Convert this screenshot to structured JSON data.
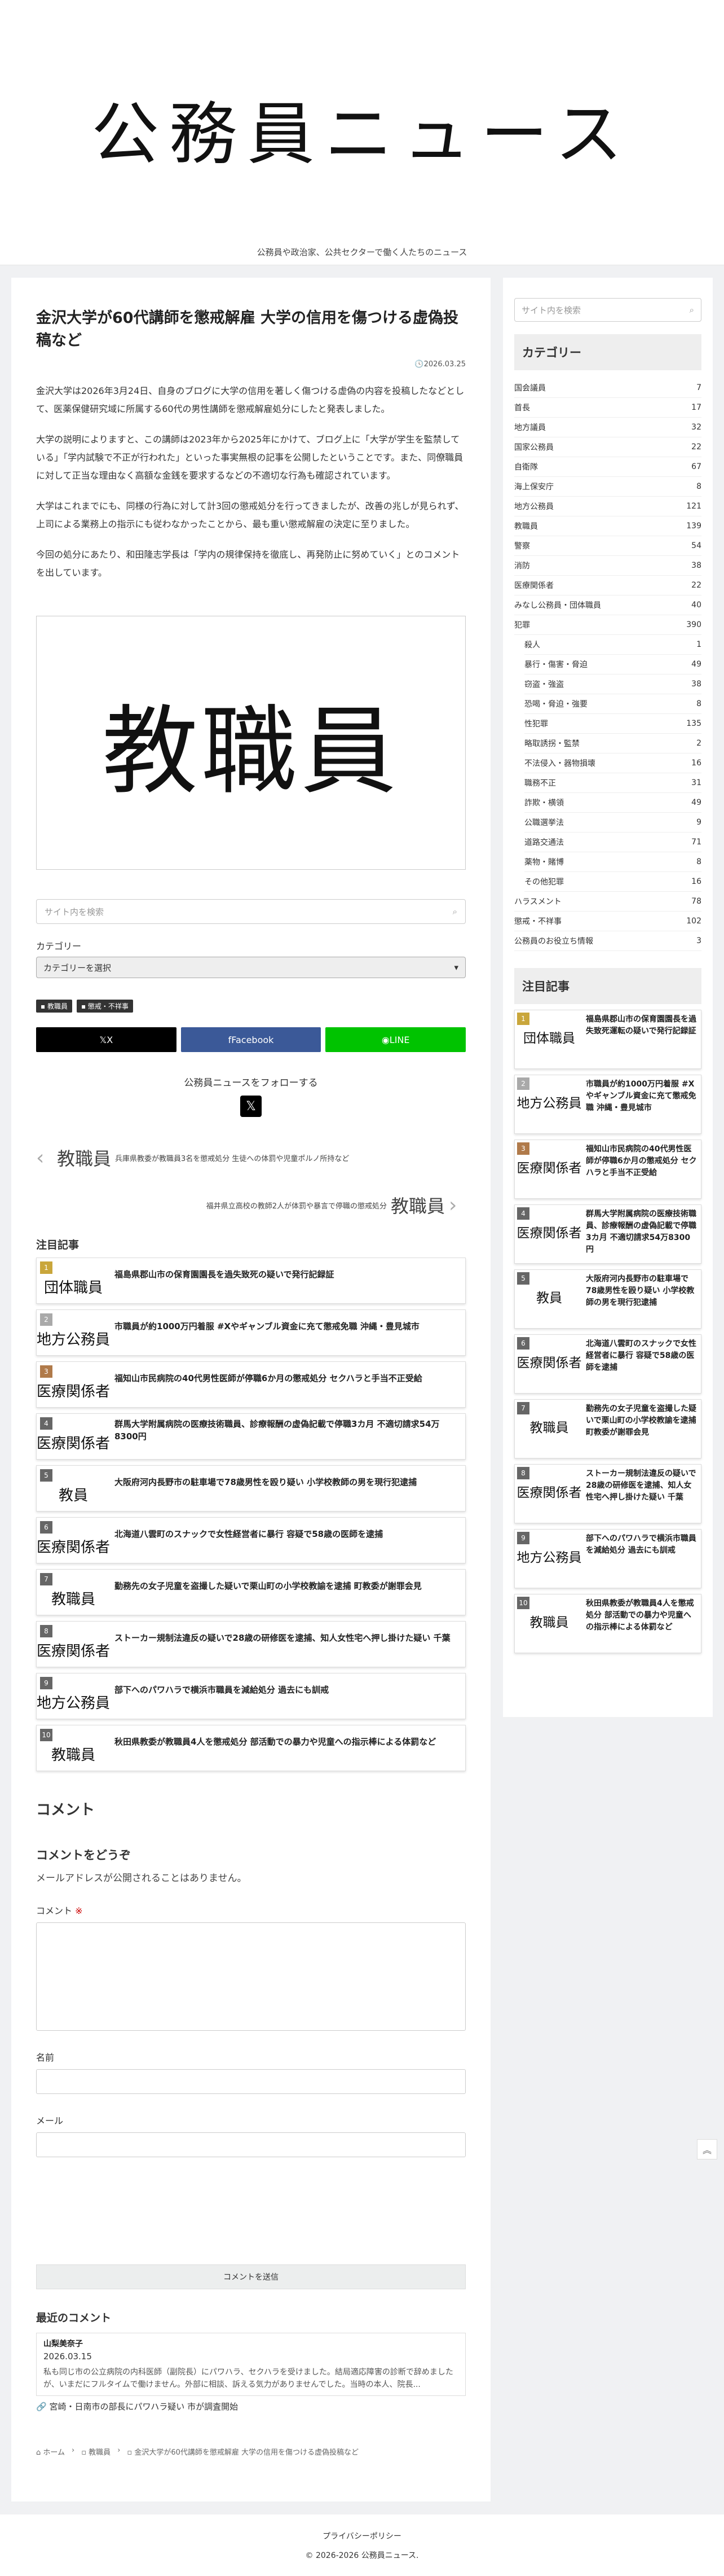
{
  "header": {
    "logo_text": "公務員ニュース",
    "tagline": "公務員や政治家、公共セクターで働く人たちのニュース"
  },
  "article": {
    "title": "金沢大学が60代講師を懲戒解雇 大学の信用を傷つける虚偽投稿など",
    "date": "2026.03.25",
    "paragraphs": [
      "金沢大学は2026年3月24日、自身のブログに大学の信用を著しく傷つける虚偽の内容を投稿したなどとして、医薬保健研究域に所属する60代の男性講師を懲戒解雇処分にしたと発表しました。",
      "大学の説明によりますと、この講師は2023年から2025年にかけて、ブログ上に「大学が学生を監禁している」「学内試験で不正が行われた」といった事実無根の記事を公開したということです。また、同僚職員に対して正当な理由なく高額な金銭を要求するなどの不適切な行為も確認されています。",
      "大学はこれまでにも、同様の行為に対して計3回の懲戒処分を行ってきましたが、改善の兆しが見られず、上司による業務上の指示にも従わなかったことから、最も重い懲戒解雇の決定に至りました。",
      "今回の処分にあたり、和田隆志学長は「学内の規律保持を徹底し、再発防止に努めていく」とのコメントを出しています。"
    ],
    "eyecatch_text": "教職員"
  },
  "search_placeholder": "サイト内を検索",
  "category_label": "カテゴリー",
  "category_select": "カテゴリーを選択",
  "tags": [
    "教職員",
    "懲戒・不祥事"
  ],
  "share": {
    "x": "X",
    "facebook": "Facebook",
    "line": "LINE"
  },
  "follow_text": "公務員ニュースをフォローする",
  "pager": {
    "prev_thumb": "教職員",
    "prev_title": "兵庫県教委が教職員3名を懲戒処分 生徒への体罰や児童ポルノ所持など",
    "next_thumb": "教職員",
    "next_title": "福井県立高校の教師2人が体罰や暴言で停職の懲戒処分"
  },
  "popular": {
    "heading": "注目記事",
    "items": [
      {
        "num": "1",
        "thumb": "団体職員",
        "title": "福島県郡山市の保育園園長を過失致死の疑いで発行記録証"
      },
      {
        "num": "2",
        "thumb": "地方公務員",
        "title": "市職員が約1000万円着服 #Xやギャンブル資金に充て懲戒免職 沖縄・豊見城市"
      },
      {
        "num": "3",
        "thumb": "医療関係者",
        "title": "福知山市民病院の40代男性医師が停職6か月の懲戒処分 セクハラと手当不正受給"
      },
      {
        "num": "4",
        "thumb": "医療関係者",
        "title": "群馬大学附属病院の医療技術職員、診療報酬の虚偽記載で停職3カ月 不適切請求54万8300円"
      },
      {
        "num": "5",
        "thumb": "教員",
        "title": "大阪府河内長野市の駐車場で78歳男性を殴り疑い 小学校教師の男を現行犯逮捕"
      },
      {
        "num": "6",
        "thumb": "医療関係者",
        "title": "北海道八雲町のスナックで女性経営者に暴行 容疑で58歳の医師を逮捕"
      },
      {
        "num": "7",
        "thumb": "教職員",
        "title": "勤務先の女子児童を盗撮した疑いで栗山町の小学校教諭を逮捕 町教委が謝罪会見"
      },
      {
        "num": "8",
        "thumb": "医療関係者",
        "title": "ストーカー規制法違反の疑いで28歳の研修医を逮捕、知人女性宅へ押し掛けた疑い 千葉"
      },
      {
        "num": "9",
        "thumb": "地方公務員",
        "title": "部下へのパワハラで横浜市職員を減給処分 過去にも訓戒"
      },
      {
        "num": "10",
        "thumb": "教職員",
        "title": "秋田県教委が教職員4人を懲戒処分 部活動での暴力や児童への指示棒による体罰など"
      }
    ]
  },
  "comments": {
    "heading": "コメント",
    "sub": "コメントをどうぞ",
    "note": "メールアドレスが公開されることはありません。",
    "comment_label": "コメント",
    "required_mark": "※",
    "name_label": "名前",
    "email_label": "メール",
    "submit": "コメントを送信"
  },
  "recent": {
    "heading": "最近のコメント",
    "author": "山梨美奈子",
    "date": "2026.03.15",
    "text": "私も同じ市の公立病院の内科医師（副院長）にパワハラ、セクハラを受けました。結局適応障害の診断で辞めましたが、いまだにフルタイムで働けません。外部に相談、訴える気力がありませんでした。当時の本人、院長...",
    "link": "宮崎・日南市の部長にパワハラ疑い 市が調査開始"
  },
  "breadcrumb": [
    "ホーム",
    "教職員",
    "金沢大学が60代講師を懲戒解雇 大学の信用を傷つける虚偽投稿など"
  ],
  "sidebar": {
    "category_heading": "カテゴリー",
    "categories": [
      {
        "name": "国会議員",
        "count": "7",
        "sub": false
      },
      {
        "name": "首長",
        "count": "17",
        "sub": false
      },
      {
        "name": "地方議員",
        "count": "32",
        "sub": false
      },
      {
        "name": "国家公務員",
        "count": "22",
        "sub": false
      },
      {
        "name": "自衛隊",
        "count": "67",
        "sub": false
      },
      {
        "name": "海上保安庁",
        "count": "8",
        "sub": false
      },
      {
        "name": "地方公務員",
        "count": "121",
        "sub": false
      },
      {
        "name": "教職員",
        "count": "139",
        "sub": false
      },
      {
        "name": "警察",
        "count": "54",
        "sub": false
      },
      {
        "name": "消防",
        "count": "38",
        "sub": false
      },
      {
        "name": "医療関係者",
        "count": "22",
        "sub": false
      },
      {
        "name": "みなし公務員・団体職員",
        "count": "40",
        "sub": false
      },
      {
        "name": "犯罪",
        "count": "390",
        "sub": false
      },
      {
        "name": "殺人",
        "count": "1",
        "sub": true
      },
      {
        "name": "暴行・傷害・脅迫",
        "count": "49",
        "sub": true
      },
      {
        "name": "窃盗・強盗",
        "count": "38",
        "sub": true
      },
      {
        "name": "恐喝・脅迫・強要",
        "count": "8",
        "sub": true
      },
      {
        "name": "性犯罪",
        "count": "135",
        "sub": true
      },
      {
        "name": "略取誘拐・監禁",
        "count": "2",
        "sub": true
      },
      {
        "name": "不法侵入・器物損壊",
        "count": "16",
        "sub": true
      },
      {
        "name": "職務不正",
        "count": "31",
        "sub": true
      },
      {
        "name": "詐欺・横領",
        "count": "49",
        "sub": true
      },
      {
        "name": "公職選挙法",
        "count": "9",
        "sub": true
      },
      {
        "name": "道路交通法",
        "count": "71",
        "sub": true
      },
      {
        "name": "薬物・賭博",
        "count": "8",
        "sub": true
      },
      {
        "name": "その他犯罪",
        "count": "16",
        "sub": true
      },
      {
        "name": "ハラスメント",
        "count": "78",
        "sub": false
      },
      {
        "name": "懲戒・不祥事",
        "count": "102",
        "sub": false
      },
      {
        "name": "公務員のお役立ち情報",
        "count": "3",
        "sub": false
      }
    ],
    "popular_heading": "注目記事",
    "popular": [
      {
        "num": "1",
        "thumb": "団体職員",
        "title": "福島県郡山市の保育園園長を過失致死運転の疑いで発行記録証"
      },
      {
        "num": "2",
        "thumb": "地方公務員",
        "title": "市職員が約1000万円着服 #Xやギャンブル資金に充て懲戒免職 沖縄・豊見城市"
      },
      {
        "num": "3",
        "thumb": "医療関係者",
        "title": "福知山市民病院の40代男性医師が停職6か月の懲戒処分 セクハラと手当不正受給"
      },
      {
        "num": "4",
        "thumb": "医療関係者",
        "title": "群馬大学附属病院の医療技術職員、診療報酬の虚偽記載で停職3カ月 不適切請求54万8300円"
      },
      {
        "num": "5",
        "thumb": "教員",
        "title": "大阪府河内長野市の駐車場で78歳男性を殴り疑い 小学校教師の男を現行犯逮捕"
      },
      {
        "num": "6",
        "thumb": "医療関係者",
        "title": "北海道八雲町のスナックで女性経営者に暴行 容疑で58歳の医師を逮捕"
      },
      {
        "num": "7",
        "thumb": "教職員",
        "title": "勤務先の女子児童を盗撮した疑いで栗山町の小学校教諭を逮捕 町教委が謝罪会見"
      },
      {
        "num": "8",
        "thumb": "医療関係者",
        "title": "ストーカー規制法違反の疑いで28歳の研修医を逮捕、知人女性宅へ押し掛けた疑い 千葉"
      },
      {
        "num": "9",
        "thumb": "地方公務員",
        "title": "部下へのパワハラで横浜市職員を減給処分 過去にも訓戒"
      },
      {
        "num": "10",
        "thumb": "教職員",
        "title": "秋田県教委が教職員4人を懲戒処分 部活動での暴力や児童への指示棒による体罰など"
      }
    ]
  },
  "footer": {
    "policy": "プライバシーポリシー",
    "copyright": "© 2026-2026 公務員ニュース."
  },
  "colors": {
    "x": "#000000",
    "facebook": "#3b5998",
    "line": "#00c300",
    "rank1": "#c9a63b",
    "rank2": "#a9a9a9",
    "rank3": "#b07a4a",
    "rank_other": "#666666"
  }
}
